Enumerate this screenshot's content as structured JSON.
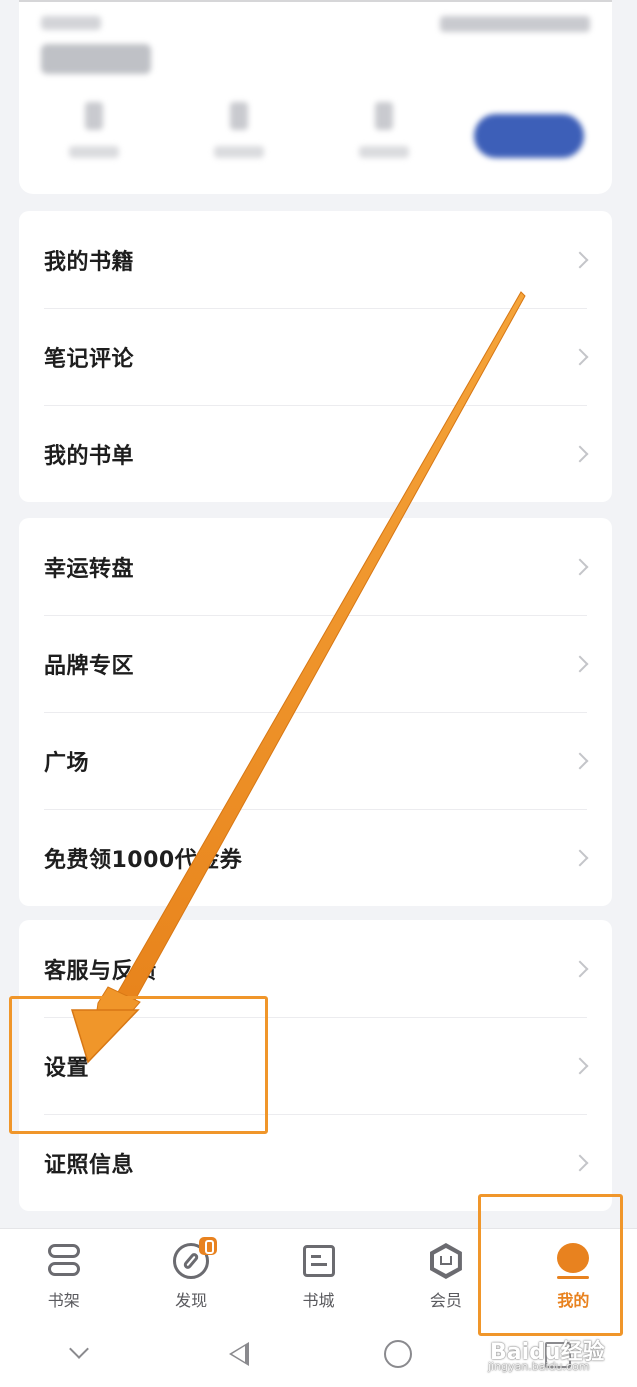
{
  "menu_groups": [
    {
      "items": [
        {
          "label": "我的书籍"
        },
        {
          "label": "笔记评论"
        },
        {
          "label": "我的书单"
        }
      ]
    },
    {
      "items": [
        {
          "label": "幸运转盘"
        },
        {
          "label": "品牌专区"
        },
        {
          "label": "广场"
        },
        {
          "label": "免费领1000代金券"
        }
      ]
    },
    {
      "items": [
        {
          "label": "客服与反馈"
        },
        {
          "label": "设置"
        },
        {
          "label": "证照信息"
        }
      ]
    }
  ],
  "tabbar": {
    "tabs": [
      {
        "label": "书架",
        "icon": "bookshelf-icon"
      },
      {
        "label": "发现",
        "icon": "compass-icon"
      },
      {
        "label": "书城",
        "icon": "bookstore-icon"
      },
      {
        "label": "会员",
        "icon": "vip-crown-icon"
      },
      {
        "label": "我的",
        "icon": "profile-icon"
      }
    ],
    "active": "我的"
  },
  "colors": {
    "accent": "#e8821f",
    "annotation": "#f0962a",
    "background": "#f2f3f6"
  },
  "watermark": {
    "brand": "Baidu经验",
    "url": "jingyan.baidu.com"
  }
}
